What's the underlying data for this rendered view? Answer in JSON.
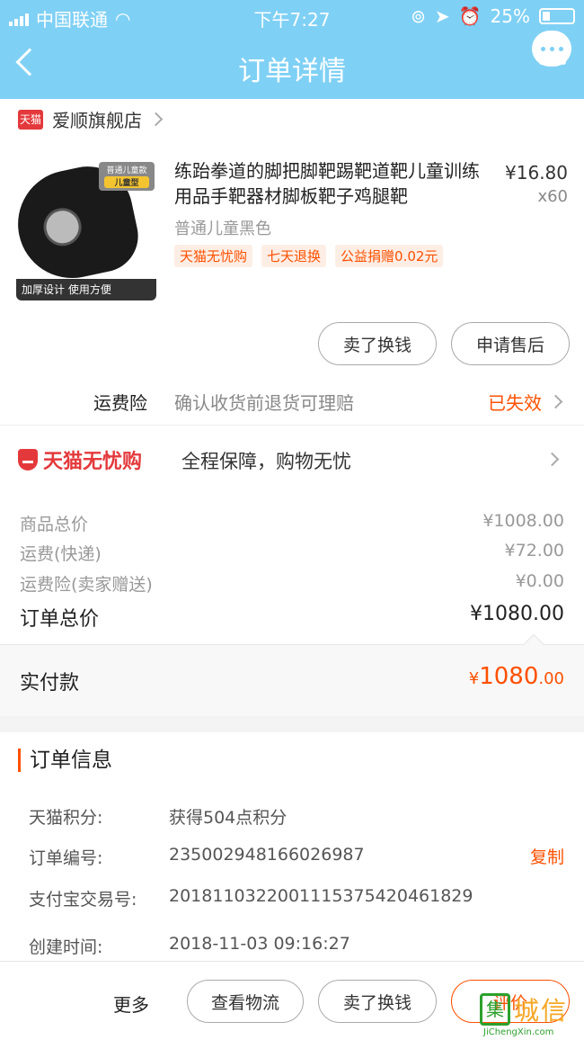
{
  "status_bar": {
    "carrier": "中国联通",
    "time": "下午7:27",
    "battery": "25%"
  },
  "nav": {
    "title": "订单详情"
  },
  "shop": {
    "badge": "天猫",
    "name": "爱顺旗舰店"
  },
  "product": {
    "image_tag_top": "普通儿童款",
    "image_tag_sub": "儿童型",
    "image_caption": "加厚设计 使用方便",
    "title": "练跆拳道的脚把脚靶踢靶道靶儿童训练用品手靶器材脚板靶子鸡腿靶",
    "price": "¥16.80",
    "quantity": "x60",
    "sku": "普通儿童黑色",
    "tags": [
      "天猫无忧购",
      "七天退换",
      "公益捐赠0.02元"
    ],
    "buttons": {
      "sell": "卖了换钱",
      "after_sale": "申请售后"
    }
  },
  "insurance": {
    "label": "运费险",
    "desc": "确认收货前退货可理赔",
    "status": "已失效"
  },
  "guarantee": {
    "brand": "天猫无忧购",
    "text": "全程保障，购物无忧"
  },
  "prices": {
    "rows": [
      {
        "label": "商品总价",
        "value": "¥1008.00"
      },
      {
        "label": "运费(快递)",
        "value": "¥72.00"
      },
      {
        "label": "运费险(卖家赠送)",
        "value": "¥0.00"
      }
    ],
    "total_label": "订单总价",
    "total_value": "¥1080.00"
  },
  "paid": {
    "label": "实付款",
    "currency": "¥",
    "integer": "1080",
    "decimal": ".00"
  },
  "order_info": {
    "title": "订单信息",
    "rows": [
      {
        "label": "天猫积分:",
        "value": "获得504点积分"
      },
      {
        "label": "订单编号:",
        "value": "235002948166026987"
      },
      {
        "label": "支付宝交易号:",
        "value": "2018110322001115375420461829"
      },
      {
        "label": "创建时间:",
        "value": "2018-11-03 09:16:27"
      }
    ],
    "copy_label": "复制"
  },
  "bottom": {
    "more": "更多",
    "logistics": "查看物流",
    "sell": "卖了换钱",
    "review": "评价"
  },
  "watermark": {
    "box": "集",
    "text": "城信",
    "sub": "JiChengXin.com"
  },
  "colors": {
    "header": "#7fd0f5",
    "accent": "#ff5000",
    "tmall_red": "#e4393c"
  }
}
